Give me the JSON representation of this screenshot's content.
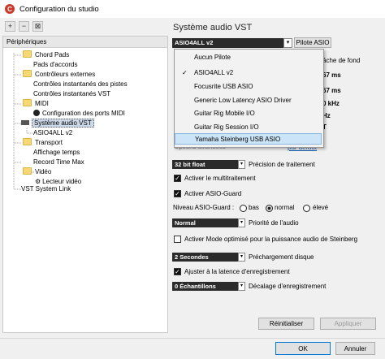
{
  "window": {
    "title": "Configuration du studio"
  },
  "toolbar": {
    "add_label": "+",
    "remove_label": "−",
    "reset_label": "⊠"
  },
  "tree": {
    "header": "Périphériques",
    "items": [
      "Chord Pads",
      "Pads d'accords",
      "Contrôleurs externes",
      "Contrôles instantanés des pistes",
      "Contrôles instantanés VST",
      "MIDI",
      "Configuration des ports MIDI",
      "Système audio VST",
      "ASIO4ALL v2",
      "Transport",
      "Affichage temps",
      "Record Time Max",
      "Vidéo",
      "Lecteur vidéo",
      "VST System Link"
    ]
  },
  "main": {
    "title": "Système audio VST",
    "driver_value": "ASIO4ALL v2",
    "pilote_button": "Pilote ASIO",
    "bg_tache": "âche de fond",
    "bg_ms1": "67 ms",
    "bg_ms2": "67 ms",
    "bg_khz": "0 kHz",
    "bg_hz": "Hz",
    "bg_t": "T",
    "options_avancees": "Options avancées",
    "link_defaut": "par défaut",
    "precision_value": "32 bit float",
    "precision_label": "Précision de traitement",
    "multithread_label": "Activer le multitraitement",
    "asioguard_label": "Activer ASIO-Guard",
    "niveau_label": "Niveau ASIO-Guard :",
    "niveau_bas": "bas",
    "niveau_normal": "normal",
    "niveau_eleve": "élevé",
    "priorite_value": "Normal",
    "priorite_label": "Priorité de l'audio",
    "steinberg_label": "Activer Mode optimisé pour la puissance audio de Steinberg",
    "prechargement_value": "2 Secondes",
    "prechargement_label": "Préchargement disque",
    "latence_label": "Ajuster à la latence d'enregistrement",
    "decalage_value": "0 Échantillons",
    "decalage_label": "Décalage d'enregistrement"
  },
  "dropdown": {
    "items": [
      "Aucun Pilote",
      "ASIO4ALL v2",
      "Focusrite USB ASIO",
      "Generic Low Latency ASIO Driver",
      "Guitar Rig Mobile I/O",
      "Guitar Rig Session I/O",
      "Yamaha Steinberg USB ASIO"
    ],
    "checked_item": "ASIO4ALL v2",
    "highlighted_item": "Yamaha Steinberg USB ASIO"
  },
  "buttons": {
    "reinitialiser": "Réinitialiser",
    "appliquer": "Appliquer",
    "ok": "OK",
    "annuler": "Annuler"
  },
  "colors": {
    "accent": "#0078d7",
    "highlight": "#cce4f7",
    "folder": "#f8d775"
  }
}
